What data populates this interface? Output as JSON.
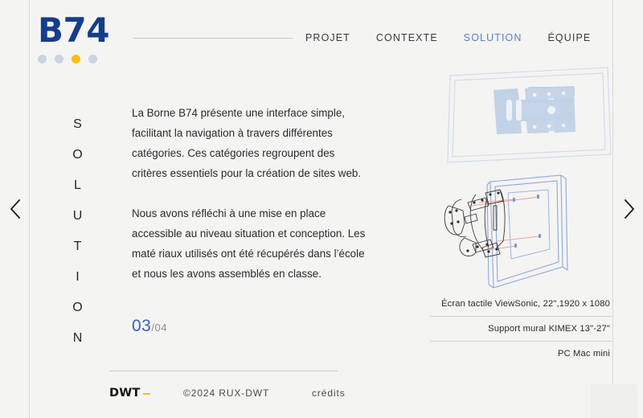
{
  "brand": {
    "logo": "B74",
    "logo_color": "#153d8a"
  },
  "carousel": {
    "dots": [
      {
        "active": false
      },
      {
        "active": false
      },
      {
        "active": true
      },
      {
        "active": false
      }
    ],
    "active_color": "#f7c013",
    "inactive_color": "#ccd4e2",
    "prev_label": "‹",
    "next_label": "›"
  },
  "nav": {
    "items": [
      {
        "label": "PROJET",
        "active": false
      },
      {
        "label": "CONTEXTE",
        "active": false
      },
      {
        "label": "SOLUTION",
        "active": true
      },
      {
        "label": "ÉQUIPE",
        "active": false
      }
    ],
    "active_color": "#5b7fc7"
  },
  "section": {
    "vertical_title": "SOLUTION",
    "paragraphs": [
      "La Borne B74 présente  une interface simple, facilitant la navigation à travers différentes catégories. Ces catégories regroupent des critères essentiels pour la création de sites web.",
      "Nous avons réfléchi à une mise en place accessible au niveau situation et conception. Les maté riaux utilisés ont été récupérés dans l’école et nous les avons assemblés en classe."
    ]
  },
  "pagination": {
    "current": "03",
    "total": "/04",
    "current_color": "#3a63b8"
  },
  "specs": {
    "items": [
      "Écran tactile ViewSonic, 22\",1920 x 1080",
      "Support mural KIMEX 13\"-27\"",
      "PC Mac mini"
    ]
  },
  "visuals": {
    "top_alt": "wall-mount-bracket-on-screen-illustration",
    "bottom_alt": "screen-mount-assembly-line-drawing"
  },
  "footer": {
    "brand": "DWT",
    "copyright": "©2024 RUX-DWT",
    "credits": "crédits",
    "accent_color": "#f7c013"
  }
}
